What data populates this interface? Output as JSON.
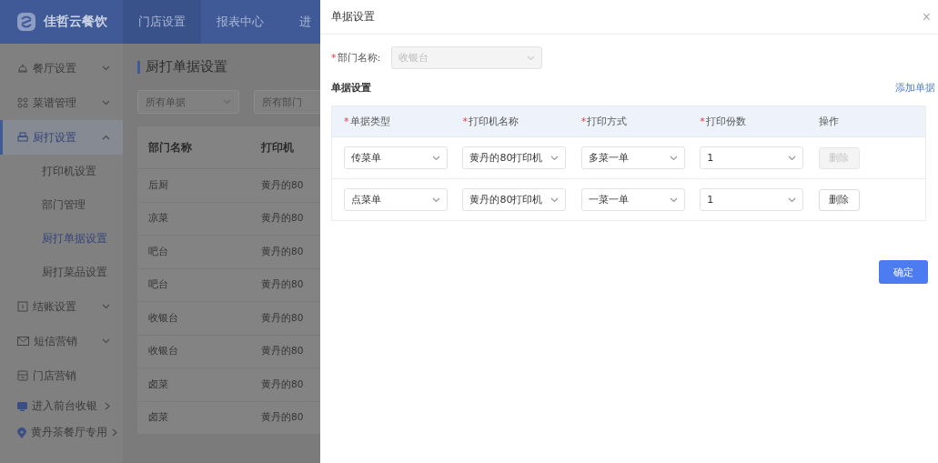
{
  "header": {
    "logo": "佳哲云餐饮",
    "nav": [
      {
        "label": "门店设置",
        "selected": true
      },
      {
        "label": "报表中心",
        "selected": false
      },
      {
        "label": "进",
        "selected": false
      }
    ]
  },
  "sidebar": {
    "items": [
      {
        "label": "餐厅设置",
        "kind": "menu",
        "expanded": false,
        "selected": false
      },
      {
        "label": "菜谱管理",
        "kind": "menu",
        "expanded": false,
        "selected": false
      },
      {
        "label": "厨打设置",
        "kind": "menu",
        "expanded": true,
        "selected": true,
        "children": [
          {
            "label": "打印机设置",
            "selected": false
          },
          {
            "label": "部门管理",
            "selected": false
          },
          {
            "label": "厨打单据设置",
            "selected": true
          },
          {
            "label": "厨打菜品设置",
            "selected": false
          }
        ]
      },
      {
        "label": "结账设置",
        "kind": "menu",
        "expanded": false,
        "selected": false
      },
      {
        "label": "短信营销",
        "kind": "menu",
        "expanded": false,
        "selected": false
      },
      {
        "label": "门店营销",
        "kind": "plain",
        "selected": false
      },
      {
        "label": "进入前台收银",
        "kind": "link",
        "selected": false
      },
      {
        "label": "黄丹茶餐厅专用",
        "kind": "link",
        "selected": false
      }
    ]
  },
  "main": {
    "title": "厨打单据设置",
    "filters": [
      {
        "placeholder": "所有单据"
      },
      {
        "placeholder": "所有部门"
      }
    ],
    "table": {
      "columns": [
        "部门名称",
        "打印机"
      ],
      "rows": [
        [
          "后厨",
          "黄丹的80"
        ],
        [
          "凉菜",
          "黄丹的80"
        ],
        [
          "吧台",
          "黄丹的80"
        ],
        [
          "吧台",
          "黄丹的80"
        ],
        [
          "收银台",
          "黄丹的80"
        ],
        [
          "收银台",
          "黄丹的80"
        ],
        [
          "卤菜",
          "黄丹的80"
        ],
        [
          "卤菜",
          "黄丹的80"
        ]
      ]
    }
  },
  "drawer": {
    "title": "单据设置",
    "close": "×",
    "department": {
      "mark": "*",
      "label": "部门名称:",
      "value": "收银台",
      "disabled": true
    },
    "section_title": "单据设置",
    "add_link": "添加单据",
    "columns": [
      {
        "mark": "*",
        "label": "单据类型"
      },
      {
        "mark": "*",
        "label": "打印机名称"
      },
      {
        "mark": "*",
        "label": "打印方式"
      },
      {
        "mark": "*",
        "label": "打印份数"
      },
      {
        "label": "操作"
      }
    ],
    "rows": [
      {
        "cells": [
          "传菜单",
          "黄丹的80打印机",
          "多菜一单",
          "1"
        ],
        "delete": {
          "label": "删除",
          "disabled": true
        }
      },
      {
        "cells": [
          "点菜单",
          "黄丹的80打印机",
          "一菜一单",
          "1"
        ],
        "delete": {
          "label": "删除",
          "disabled": false
        }
      }
    ],
    "confirm": "确定"
  }
}
